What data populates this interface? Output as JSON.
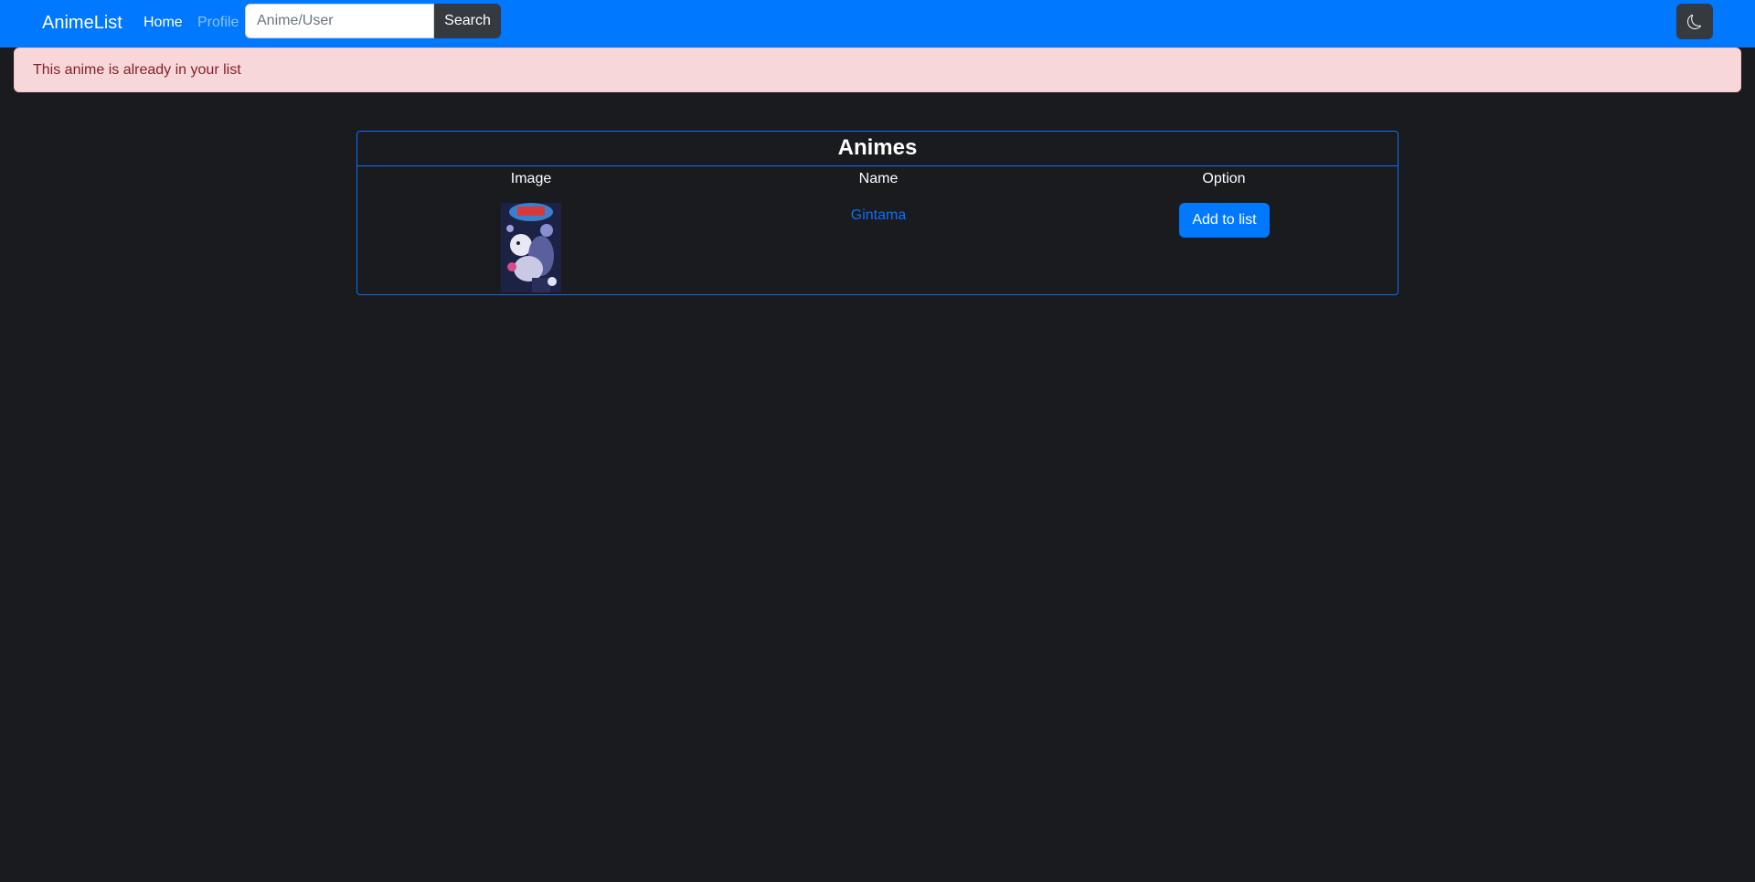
{
  "navbar": {
    "brand": "AnimeList",
    "home_label": "Home",
    "profile_label": "Profile",
    "search_placeholder": "Anime/User",
    "search_value": "",
    "search_label": "Search",
    "theme_icon": "moon-icon"
  },
  "alert": {
    "message": "This anime is already in your list"
  },
  "animes_table": {
    "title": "Animes",
    "headers": {
      "image": "Image",
      "name": "Name",
      "option": "Option"
    },
    "rows": [
      {
        "image_alt": "Gintama poster",
        "name": "Gintama",
        "action_label": "Add to list"
      }
    ]
  },
  "colors": {
    "navbar_bg": "#0078ff",
    "page_bg": "#1a1b1e",
    "alert_bg": "#f8d7da",
    "alert_text": "#842029",
    "link": "#0d6efd",
    "button_dark": "#343a40"
  }
}
